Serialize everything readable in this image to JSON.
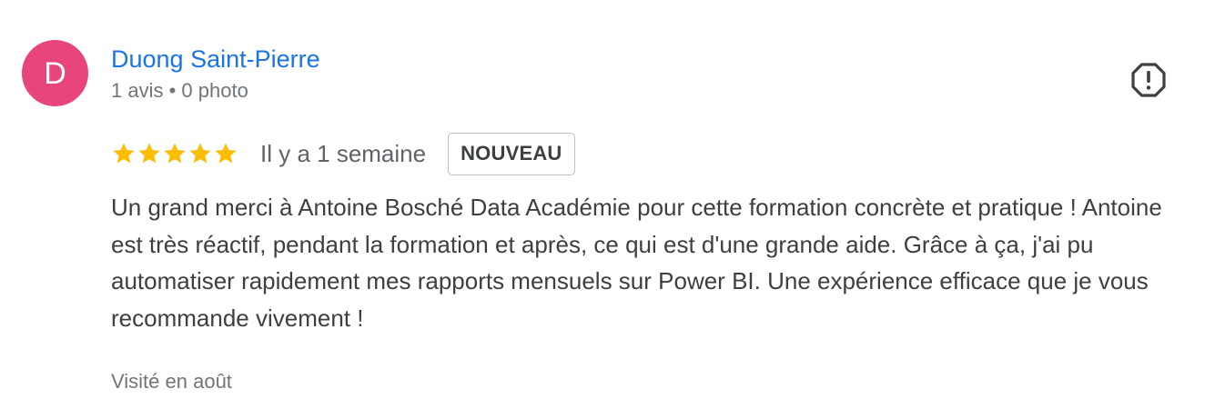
{
  "review": {
    "author": {
      "initial": "D",
      "name": "Duong Saint-Pierre",
      "meta": "1 avis • 0 photo",
      "avatar_color": "#e8457a"
    },
    "rating": 5,
    "rating_max": 5,
    "date": "Il y a 1 semaine",
    "badge": "NOUVEAU",
    "text": "Un grand merci à Antoine Bosché Data Académie pour cette formation concrète et pratique ! Antoine est très réactif, pendant la formation et après, ce qui est d'une grande aide. Grâce à ça, j'ai pu automatiser rapidement mes rapports mensuels sur Power BI. Une expérience efficace que je vous recommande vivement !",
    "visited": "Visité en août",
    "report_icon": "report-icon"
  },
  "colors": {
    "link": "#1a73e8",
    "star": "#fbbc04",
    "secondary_text": "#70757a"
  }
}
